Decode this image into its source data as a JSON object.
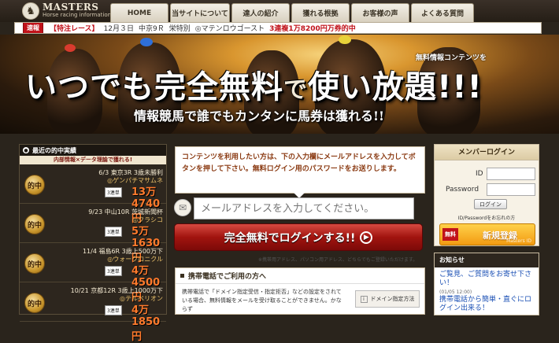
{
  "logo": {
    "title": "MASTERS",
    "subtitle": "Horse racing information"
  },
  "nav": {
    "tabs": [
      {
        "label": "HOME"
      },
      {
        "label": "当サイトについて"
      },
      {
        "label": "達人の紹介"
      },
      {
        "label": "獲れる根拠"
      },
      {
        "label": "お客様の声"
      },
      {
        "label": "よくある質問"
      }
    ]
  },
  "ticker": {
    "badge": "速報",
    "label": "【特注レース】",
    "date": "12月３日",
    "race": "中京9Ｒ",
    "condition": "栄特別",
    "horse": "◎マテンロウゴースト",
    "result": "3連複1万8200円万券的中"
  },
  "hero": {
    "sub": "無料情報コンテンツを",
    "headline_a": "いつでも完全無料",
    "headline_b": "で",
    "headline_c": "使い放題!!!",
    "tagline": "情報競馬で誰でもカンタンに馬券は獲れる!!"
  },
  "hits": {
    "title": "最近の的中実績",
    "band": "内部情報×データ理論で獲れる!",
    "medal": "的中",
    "items": [
      {
        "line1": "6/3 東京3R 3歳未勝利",
        "horse": "◎ゲンパチマサムネ",
        "type": "3連単",
        "amount": "13万4740円"
      },
      {
        "line1": "9/23 中山10R 茨城新聞杯",
        "horse": "◎クラシコ",
        "type": "3連単",
        "amount": "5万1630円"
      },
      {
        "line1": "11/4 福島6R 3歳上500万下",
        "horse": "◎ウォークロニクル",
        "type": "3連単",
        "amount": "4万4500円"
      },
      {
        "line1": "10/21 京都12R 3歳上1000万下",
        "horse": "◎テルペリオン",
        "type": "3連単",
        "amount": "4万1850円"
      }
    ]
  },
  "signup": {
    "instructions": "コンテンツを利用したい方は、下の入力欄にメールアドレスを入力してボタンを押して下さい。無料ログイン用のパスワードをお送りします。",
    "email_placeholder": "メールアドレスを入力してください。",
    "button_label": "完全無料でログインする!!",
    "note": "※携帯用アドレス、パソコン用アドレス、どちらでもご登録いただけます。"
  },
  "mobile": {
    "title": "携帯電話でご利用の方へ",
    "body": "携帯電話で「ドメイン指定受信・指定拒否」などの設定をされている場合、無料情報をメールを受け取ることができません。かならず",
    "spec_label": "ドメイン指定方法"
  },
  "member_login": {
    "title": "メンバーログイン",
    "id_label": "ID",
    "password_label": "Password",
    "login_button": "ログイン",
    "forgot": "ID/Passwordをお忘れの方",
    "register_badge": "無料",
    "register_label": "新規登録",
    "register_watermark": "Masters ID"
  },
  "news": {
    "title": "お知らせ",
    "items": [
      {
        "text": "ご覧見、ご質問をお寄せ下さい！",
        "date": "(01/05 12:00)"
      },
      {
        "text": "携帯電話から簡単・直ぐにログイン出来る！",
        "date": ""
      }
    ]
  },
  "colors": {
    "accent_red": "#c1121a",
    "gold": "#f29b12",
    "dark_panel": "#2d261e",
    "amount_orange": "#ff7a2c"
  }
}
